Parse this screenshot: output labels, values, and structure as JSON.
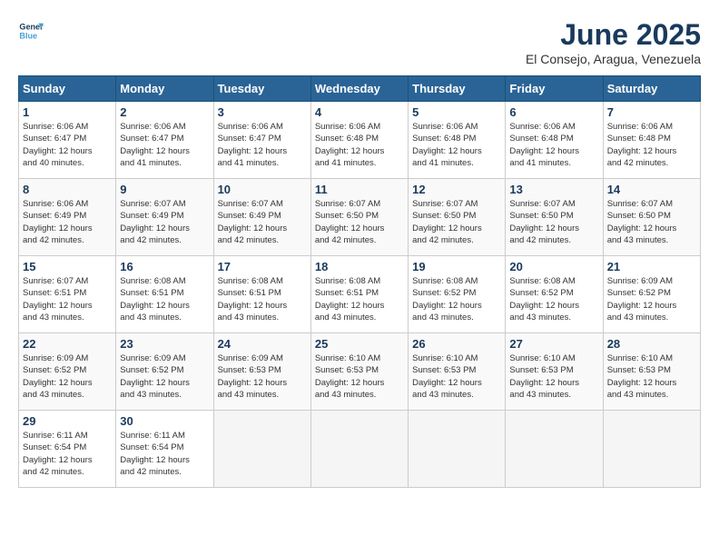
{
  "header": {
    "logo_line1": "General",
    "logo_line2": "Blue",
    "title": "June 2025",
    "subtitle": "El Consejo, Aragua, Venezuela"
  },
  "days_of_week": [
    "Sunday",
    "Monday",
    "Tuesday",
    "Wednesday",
    "Thursday",
    "Friday",
    "Saturday"
  ],
  "weeks": [
    [
      {
        "day": "1",
        "info": "Sunrise: 6:06 AM\nSunset: 6:47 PM\nDaylight: 12 hours\nand 40 minutes."
      },
      {
        "day": "2",
        "info": "Sunrise: 6:06 AM\nSunset: 6:47 PM\nDaylight: 12 hours\nand 41 minutes."
      },
      {
        "day": "3",
        "info": "Sunrise: 6:06 AM\nSunset: 6:47 PM\nDaylight: 12 hours\nand 41 minutes."
      },
      {
        "day": "4",
        "info": "Sunrise: 6:06 AM\nSunset: 6:48 PM\nDaylight: 12 hours\nand 41 minutes."
      },
      {
        "day": "5",
        "info": "Sunrise: 6:06 AM\nSunset: 6:48 PM\nDaylight: 12 hours\nand 41 minutes."
      },
      {
        "day": "6",
        "info": "Sunrise: 6:06 AM\nSunset: 6:48 PM\nDaylight: 12 hours\nand 41 minutes."
      },
      {
        "day": "7",
        "info": "Sunrise: 6:06 AM\nSunset: 6:48 PM\nDaylight: 12 hours\nand 42 minutes."
      }
    ],
    [
      {
        "day": "8",
        "info": "Sunrise: 6:06 AM\nSunset: 6:49 PM\nDaylight: 12 hours\nand 42 minutes."
      },
      {
        "day": "9",
        "info": "Sunrise: 6:07 AM\nSunset: 6:49 PM\nDaylight: 12 hours\nand 42 minutes."
      },
      {
        "day": "10",
        "info": "Sunrise: 6:07 AM\nSunset: 6:49 PM\nDaylight: 12 hours\nand 42 minutes."
      },
      {
        "day": "11",
        "info": "Sunrise: 6:07 AM\nSunset: 6:50 PM\nDaylight: 12 hours\nand 42 minutes."
      },
      {
        "day": "12",
        "info": "Sunrise: 6:07 AM\nSunset: 6:50 PM\nDaylight: 12 hours\nand 42 minutes."
      },
      {
        "day": "13",
        "info": "Sunrise: 6:07 AM\nSunset: 6:50 PM\nDaylight: 12 hours\nand 42 minutes."
      },
      {
        "day": "14",
        "info": "Sunrise: 6:07 AM\nSunset: 6:50 PM\nDaylight: 12 hours\nand 43 minutes."
      }
    ],
    [
      {
        "day": "15",
        "info": "Sunrise: 6:07 AM\nSunset: 6:51 PM\nDaylight: 12 hours\nand 43 minutes."
      },
      {
        "day": "16",
        "info": "Sunrise: 6:08 AM\nSunset: 6:51 PM\nDaylight: 12 hours\nand 43 minutes."
      },
      {
        "day": "17",
        "info": "Sunrise: 6:08 AM\nSunset: 6:51 PM\nDaylight: 12 hours\nand 43 minutes."
      },
      {
        "day": "18",
        "info": "Sunrise: 6:08 AM\nSunset: 6:51 PM\nDaylight: 12 hours\nand 43 minutes."
      },
      {
        "day": "19",
        "info": "Sunrise: 6:08 AM\nSunset: 6:52 PM\nDaylight: 12 hours\nand 43 minutes."
      },
      {
        "day": "20",
        "info": "Sunrise: 6:08 AM\nSunset: 6:52 PM\nDaylight: 12 hours\nand 43 minutes."
      },
      {
        "day": "21",
        "info": "Sunrise: 6:09 AM\nSunset: 6:52 PM\nDaylight: 12 hours\nand 43 minutes."
      }
    ],
    [
      {
        "day": "22",
        "info": "Sunrise: 6:09 AM\nSunset: 6:52 PM\nDaylight: 12 hours\nand 43 minutes."
      },
      {
        "day": "23",
        "info": "Sunrise: 6:09 AM\nSunset: 6:52 PM\nDaylight: 12 hours\nand 43 minutes."
      },
      {
        "day": "24",
        "info": "Sunrise: 6:09 AM\nSunset: 6:53 PM\nDaylight: 12 hours\nand 43 minutes."
      },
      {
        "day": "25",
        "info": "Sunrise: 6:10 AM\nSunset: 6:53 PM\nDaylight: 12 hours\nand 43 minutes."
      },
      {
        "day": "26",
        "info": "Sunrise: 6:10 AM\nSunset: 6:53 PM\nDaylight: 12 hours\nand 43 minutes."
      },
      {
        "day": "27",
        "info": "Sunrise: 6:10 AM\nSunset: 6:53 PM\nDaylight: 12 hours\nand 43 minutes."
      },
      {
        "day": "28",
        "info": "Sunrise: 6:10 AM\nSunset: 6:53 PM\nDaylight: 12 hours\nand 43 minutes."
      }
    ],
    [
      {
        "day": "29",
        "info": "Sunrise: 6:11 AM\nSunset: 6:54 PM\nDaylight: 12 hours\nand 42 minutes."
      },
      {
        "day": "30",
        "info": "Sunrise: 6:11 AM\nSunset: 6:54 PM\nDaylight: 12 hours\nand 42 minutes."
      },
      {
        "day": "",
        "info": ""
      },
      {
        "day": "",
        "info": ""
      },
      {
        "day": "",
        "info": ""
      },
      {
        "day": "",
        "info": ""
      },
      {
        "day": "",
        "info": ""
      }
    ]
  ]
}
